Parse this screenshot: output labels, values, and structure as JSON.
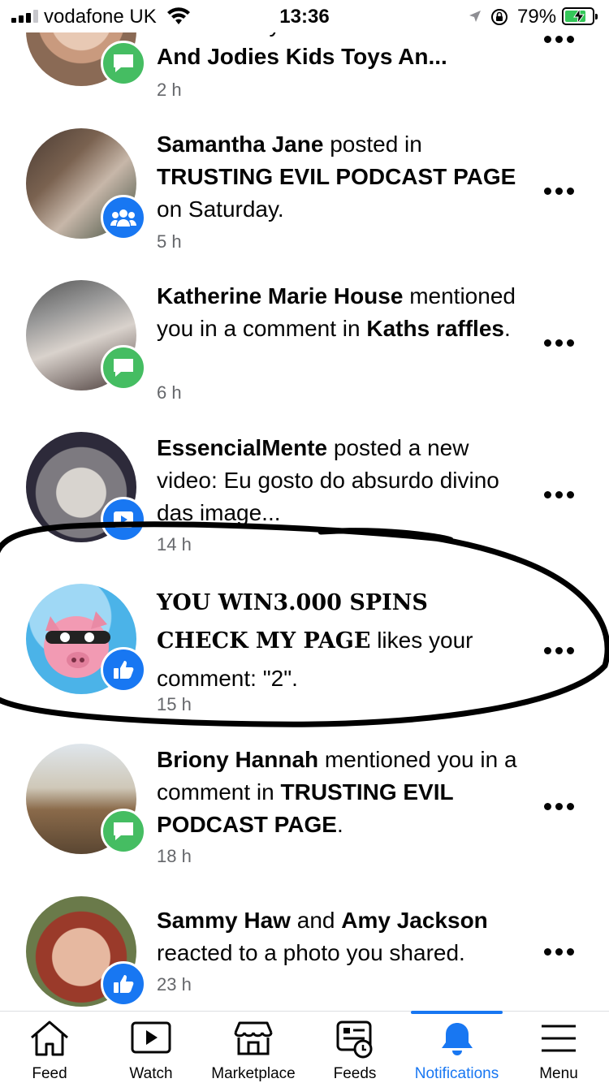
{
  "status_bar": {
    "carrier": "vodafone UK",
    "time": "13:36",
    "battery": "79%",
    "battery_fraction": 0.79
  },
  "notifications": [
    {
      "text_parts": [
        {
          "t": "mentioned you in a comment in",
          "b": false
        },
        {
          "t": "Loz And Jodies Kids Toys An...",
          "b": true
        }
      ],
      "time": "2 h",
      "badge": "comment-icon"
    },
    {
      "text_parts": [
        {
          "t": "Samantha Jane",
          "b": true
        },
        {
          "t": " posted in ",
          "b": false
        },
        {
          "t": "TRUSTING EVIL PODCAST PAGE",
          "b": true
        },
        {
          "t": " on Saturday.",
          "b": false
        }
      ],
      "time": "5 h",
      "badge": "group-icon"
    },
    {
      "text_parts": [
        {
          "t": "Katherine Marie House",
          "b": true
        },
        {
          "t": " mentioned you in a comment in ",
          "b": false
        },
        {
          "t": "Kaths raffles",
          "b": true
        },
        {
          "t": ".",
          "b": false
        }
      ],
      "time": "6 h",
      "badge": "comment-icon"
    },
    {
      "text_parts": [
        {
          "t": "EssencialMente",
          "b": true
        },
        {
          "t": " posted a new video: Eu gosto do absurdo divino das image...",
          "b": false
        }
      ],
      "time": "14 h",
      "badge": "video-icon"
    },
    {
      "text_parts": [
        {
          "t": "YOU WIN3.000 SPINS CHECK MY PAGE",
          "b": true,
          "serif": true
        },
        {
          "t": " likes your comment: \"2\".",
          "b": false
        }
      ],
      "time": "15 h",
      "badge": "like-icon"
    },
    {
      "text_parts": [
        {
          "t": "Briony Hannah",
          "b": true
        },
        {
          "t": " mentioned you in a comment in ",
          "b": false
        },
        {
          "t": "TRUSTING EVIL PODCAST PAGE",
          "b": true
        },
        {
          "t": ".",
          "b": false
        }
      ],
      "time": "18 h",
      "badge": "comment-icon"
    },
    {
      "text_parts": [
        {
          "t": "Sammy Haw",
          "b": true
        },
        {
          "t": " and ",
          "b": false
        },
        {
          "t": "Amy Jackson",
          "b": true
        },
        {
          "t": " reacted to a photo you shared.",
          "b": false
        }
      ],
      "time": "23 h",
      "badge": "like-icon"
    }
  ],
  "tabs": [
    {
      "label": "Feed",
      "icon": "home-icon"
    },
    {
      "label": "Watch",
      "icon": "watch-icon"
    },
    {
      "label": "Marketplace",
      "icon": "marketplace-icon"
    },
    {
      "label": "Feeds",
      "icon": "feeds-icon"
    },
    {
      "label": "Notifications",
      "icon": "bell-icon",
      "active": true
    },
    {
      "label": "Menu",
      "icon": "menu-icon"
    }
  ],
  "colors": {
    "accent": "#1877f2",
    "comment_badge": "#45bd62",
    "secondary_text": "#65676b"
  }
}
